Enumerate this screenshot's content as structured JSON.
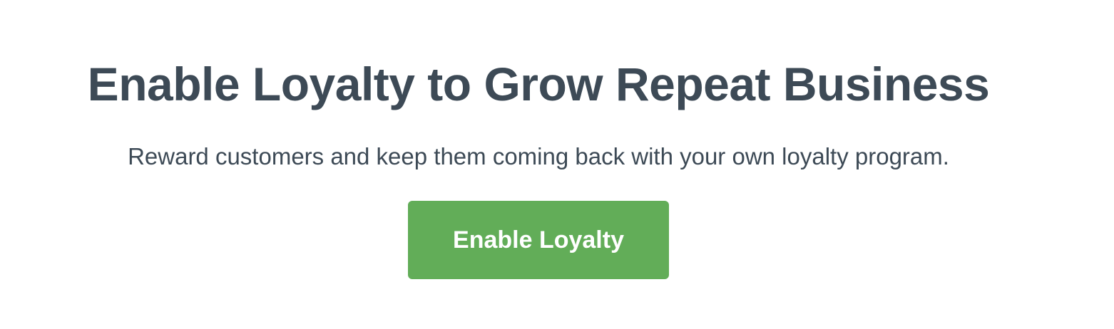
{
  "promo": {
    "title": "Enable Loyalty to Grow Repeat Business",
    "subtitle": "Reward customers and keep them coming back with your own loyalty program.",
    "button_label": "Enable Loyalty"
  },
  "colors": {
    "text": "#3d4a56",
    "button_bg": "#62ad58",
    "button_text": "#ffffff",
    "background": "#ffffff"
  }
}
